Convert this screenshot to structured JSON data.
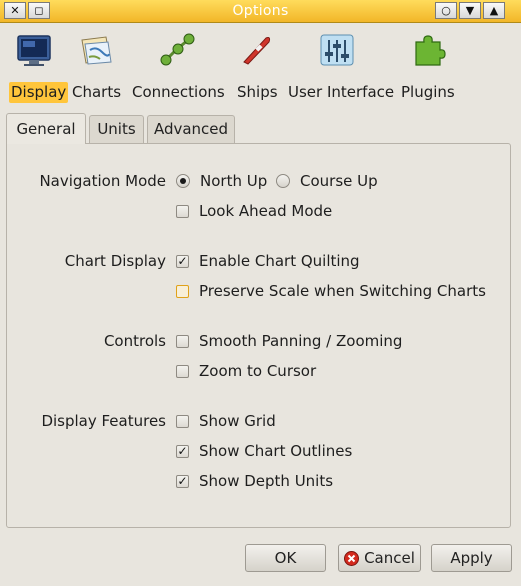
{
  "window": {
    "title": "Options"
  },
  "titlebar": {
    "close_glyph": "✕",
    "left_glyph": "◻",
    "circle_glyph": "○",
    "down_glyph": "▼",
    "up_glyph": "▲"
  },
  "toolbar": [
    {
      "label": "Display",
      "icon": "monitor-icon",
      "active": true
    },
    {
      "label": "Charts",
      "icon": "charts-icon"
    },
    {
      "label": "Connections",
      "icon": "connections-icon"
    },
    {
      "label": "Ships",
      "icon": "ship-icon"
    },
    {
      "label": "User Interface",
      "icon": "sliders-icon"
    },
    {
      "label": "Plugins",
      "icon": "puzzle-icon"
    }
  ],
  "tabs": [
    {
      "label": "General",
      "active": true
    },
    {
      "label": "Units"
    },
    {
      "label": "Advanced"
    }
  ],
  "sections": {
    "navigation": {
      "label": "Navigation Mode",
      "north_up": "North Up",
      "course_up": "Course Up",
      "look_ahead": "Look Ahead Mode",
      "selected": "North Up"
    },
    "chart_display": {
      "label": "Chart Display",
      "quilting": "Enable Chart Quilting",
      "quilting_checked": true,
      "preserve_scale": "Preserve Scale when Switching Charts",
      "preserve_scale_checked": false
    },
    "controls": {
      "label": "Controls",
      "smooth": "Smooth Panning / Zooming",
      "zoom_cursor": "Zoom to Cursor"
    },
    "features": {
      "label": "Display Features",
      "grid": "Show Grid",
      "outlines": "Show Chart Outlines",
      "depth_units": "Show Depth Units",
      "outlines_checked": true,
      "depth_checked": true
    }
  },
  "buttons": {
    "ok": "OK",
    "cancel": "Cancel",
    "apply": "Apply"
  },
  "colors": {
    "accent": "#ffc53b",
    "titlebar": "#f2b628"
  }
}
